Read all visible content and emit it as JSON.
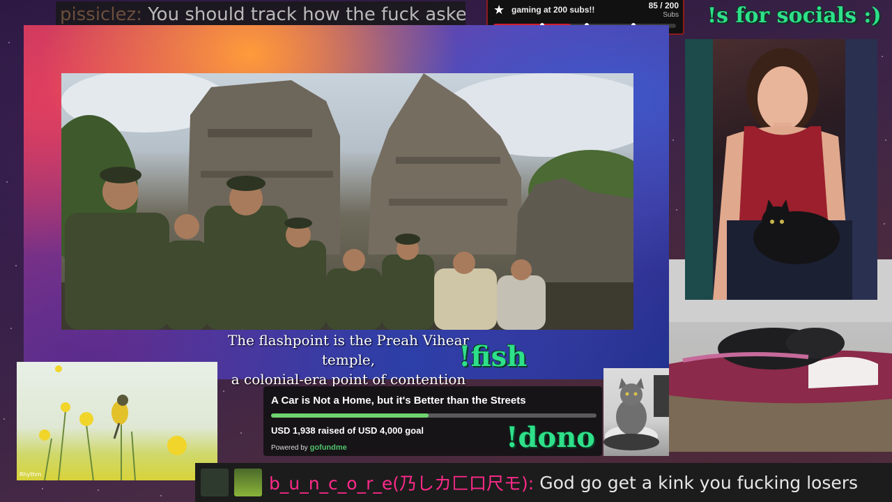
{
  "top_chat": {
    "username": "pissiclez:",
    "message": "You should track how the fuck asked"
  },
  "sub_goal": {
    "title": "gaming at 200 subs!!",
    "count": "85 / 200",
    "unit": "Subs",
    "progress_fraction": 0.425,
    "accent": "#d3202a"
  },
  "socials_label": "!s for socials :)",
  "video": {
    "subtitle_line1": "The flashpoint is the Preah Vihear temple,",
    "subtitle_line2": "a colonial-era point of contention"
  },
  "commands": {
    "fish": "!fish",
    "dono": "!dono",
    "color": "#2ee08a"
  },
  "bird_video": {
    "logo_text": "Rhythm"
  },
  "fundraiser": {
    "title": "A Car is Not a Home, but it's Better than the Streets",
    "raised_text": "USD 1,938 raised of USD 4,000 goal",
    "progress_fraction": 0.4845,
    "powered_by": "Powered by",
    "brand": "gofundme"
  },
  "bottom_chat": {
    "username": "b_u_n_c_o_r_e(乃しカ匚口尺モ):",
    "message": "God go get a kink you fucking losers"
  }
}
